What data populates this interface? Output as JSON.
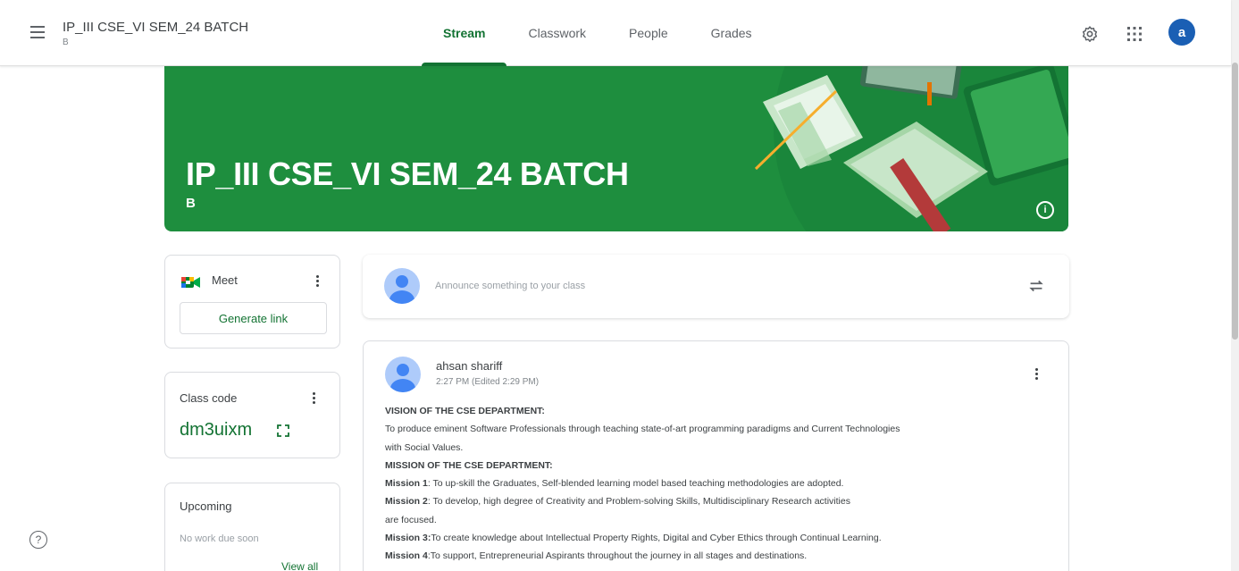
{
  "header": {
    "class_title": "IP_III CSE_VI SEM_24 BATCH",
    "class_section": "B",
    "tabs": [
      {
        "label": "Stream",
        "active": true
      },
      {
        "label": "Classwork",
        "active": false
      },
      {
        "label": "People",
        "active": false
      },
      {
        "label": "Grades",
        "active": false
      }
    ],
    "icons": [
      "menu-icon",
      "gear-icon",
      "apps-grid-icon"
    ],
    "account_initial": "a"
  },
  "banner": {
    "title": "IP_III CSE_VI SEM_24 BATCH",
    "section": "B",
    "info_glyph": "i",
    "color": "#1e8e3e"
  },
  "meet": {
    "label": "Meet",
    "button": "Generate link"
  },
  "class_code": {
    "label": "Class code",
    "value": "dm3uixm"
  },
  "upcoming": {
    "label": "Upcoming",
    "empty_text": "No work due soon",
    "view_all": "View all"
  },
  "announce": {
    "placeholder": "Announce something to your class"
  },
  "post": {
    "author": "ahsan shariff",
    "time": "2:27 PM (Edited 2:29 PM)",
    "lines": [
      {
        "bold": "VISION OF THE CSE DEPARTMENT:",
        "text": ""
      },
      {
        "bold": "",
        "text": "To produce eminent Software Professionals through teaching state-of-art programming paradigms and Current Technologies"
      },
      {
        "bold": "",
        "text": "with Social Values."
      },
      {
        "bold": "MISSION OF THE CSE DEPARTMENT:",
        "text": ""
      },
      {
        "bold": "Mission 1",
        "text": ": To up-skill the Graduates, Self-blended learning model based teaching methodologies are adopted."
      },
      {
        "bold": "Mission 2",
        "text": ": To develop, high degree of Creativity and Problem-solving Skills, Multidisciplinary Research activities"
      },
      {
        "bold": "",
        "text": "are focused."
      },
      {
        "bold": "Mission 3:",
        "text": "To create knowledge about Intellectual Property Rights, Digital and Cyber Ethics through Continual Learning."
      },
      {
        "bold": "Mission 4",
        "text": ":To support, Entrepreneurial Aspirants throughout the journey in all stages and destinations."
      }
    ]
  },
  "help_glyph": "?",
  "colors": {
    "accent": "#137333",
    "avatar": "#1a5fb4"
  }
}
